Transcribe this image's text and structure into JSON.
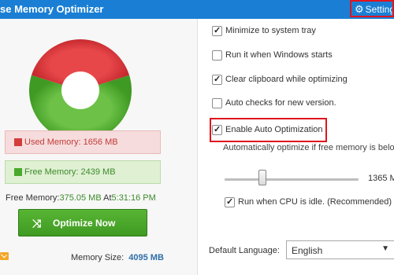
{
  "title": "se Memory Optimizer",
  "settings": {
    "label": "Setting",
    "icon": "gear-icon"
  },
  "memory": {
    "used_fraction": 0.4044,
    "used_label": "Used Memory: 1656 MB",
    "free_label": "Free Memory: 2439 MB",
    "free_after_prefix": "Free Memory:",
    "free_after_value": "375.05 MB",
    "at_prefix": " At",
    "at_time": "5:31:16 PM",
    "size_label": "Memory Size:",
    "size_value": "4095 MB"
  },
  "optimize": {
    "label": "Optimize Now",
    "icon": "shuffle-icon"
  },
  "options": [
    {
      "label": "Minimize to system tray",
      "checked": true
    },
    {
      "label": "Run it when Windows starts",
      "checked": false
    },
    {
      "label": "Clear clipboard while optimizing",
      "checked": true
    },
    {
      "label": "Auto checks for new version.",
      "checked": false
    },
    {
      "label": "Enable Auto Optimization",
      "checked": true
    }
  ],
  "auto": {
    "description": "Automatically optimize if free memory is below",
    "threshold_value": "1365 M",
    "slider_fraction": 0.28,
    "cpu_idle_label": "Run when CPU is idle. (Recommended)",
    "cpu_idle_checked": true
  },
  "language": {
    "label": "Default Language:",
    "value": "English"
  },
  "colors": {
    "used": "#d43c3c",
    "free": "#4aa82e",
    "titlebar": "#1a7fd4",
    "highlight": "#e0141e"
  }
}
